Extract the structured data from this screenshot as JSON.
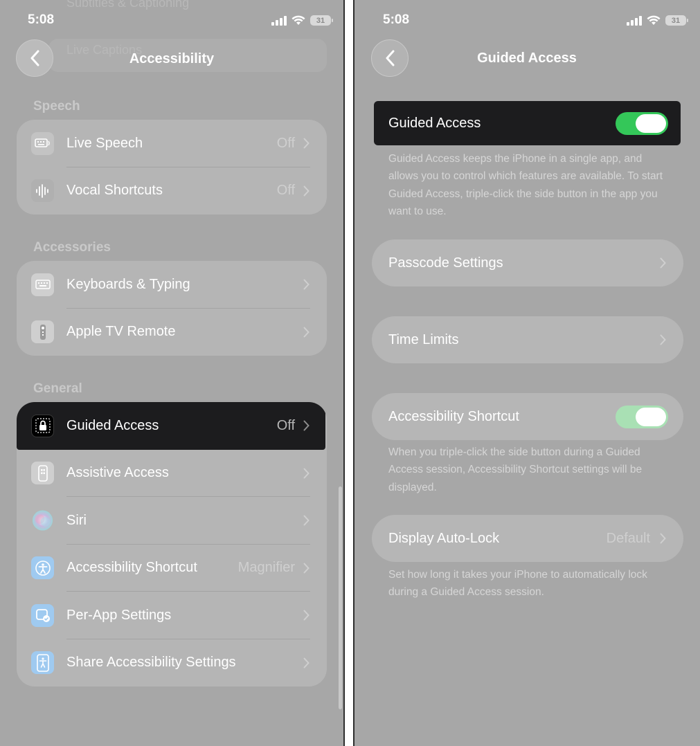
{
  "left": {
    "status": {
      "time": "5:08",
      "battery": "31"
    },
    "nav": {
      "title": "Accessibility"
    },
    "behind": {
      "top_row": "Subtitles & Captioning",
      "second_row": "Live Captions"
    },
    "sections": [
      {
        "header": "Speech",
        "rows": [
          {
            "label": "Live Speech",
            "value": "Off",
            "icon": "keyboard-speech-icon"
          },
          {
            "label": "Vocal Shortcuts",
            "value": "Off",
            "icon": "waveform-icon"
          }
        ]
      },
      {
        "header": "Accessories",
        "rows": [
          {
            "label": "Keyboards & Typing",
            "value": "",
            "icon": "keyboard-icon"
          },
          {
            "label": "Apple TV Remote",
            "value": "",
            "icon": "remote-icon"
          }
        ]
      },
      {
        "header": "General",
        "rows": [
          {
            "label": "Guided Access",
            "value": "Off",
            "icon": "lock-icon",
            "highlighted": true
          },
          {
            "label": "Assistive Access",
            "value": "",
            "icon": "assistive-access-icon"
          },
          {
            "label": "Siri",
            "value": "",
            "icon": "siri-icon"
          },
          {
            "label": "Accessibility Shortcut",
            "value": "Magnifier",
            "icon": "accessibility-icon"
          },
          {
            "label": "Per-App Settings",
            "value": "",
            "icon": "per-app-icon"
          },
          {
            "label": "Share Accessibility Settings",
            "value": "",
            "icon": "share-accessibility-icon"
          }
        ]
      }
    ]
  },
  "right": {
    "status": {
      "time": "5:08",
      "battery": "31"
    },
    "nav": {
      "title": "Guided Access"
    },
    "guided_access": {
      "label": "Guided Access",
      "on": true,
      "footer": "Guided Access keeps the iPhone in a single app, and allows you to control which features are available. To start Guided Access, triple-click the side button in the app you want to use."
    },
    "passcode": {
      "label": "Passcode Settings"
    },
    "time_limits": {
      "label": "Time Limits"
    },
    "shortcut": {
      "label": "Accessibility Shortcut",
      "on": true,
      "footer": "When you triple-click the side button during a Guided Access session, Accessibility Shortcut settings will be displayed."
    },
    "auto_lock": {
      "label": "Display Auto-Lock",
      "value": "Default",
      "footer": "Set how long it takes your iPhone to automatically lock during a Guided Access session."
    }
  },
  "colors": {
    "toggle_on": "#34c759",
    "toggle_on_dimmed": "#a9e0b4",
    "highlight": "#1c1c1e",
    "dim_background": "#a7a7a7"
  }
}
